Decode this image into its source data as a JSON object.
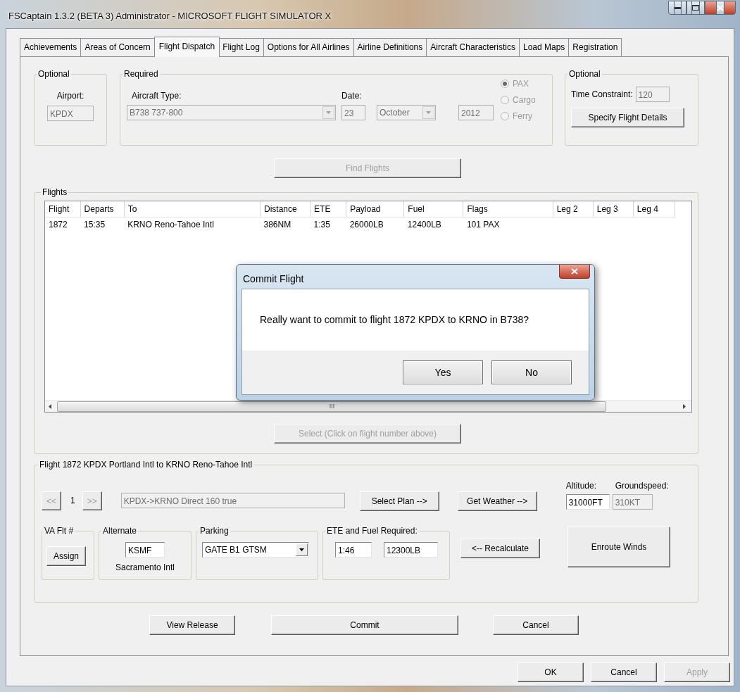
{
  "window": {
    "title": "FSCaptain 1.3.2 (BETA 3) Administrator - MICROSOFT FLIGHT SIMULATOR X"
  },
  "tabs": [
    {
      "label": "Achievements",
      "selected": false
    },
    {
      "label": "Areas of Concern",
      "selected": false
    },
    {
      "label": "Flight Dispatch",
      "selected": true
    },
    {
      "label": "Flight Log",
      "selected": false
    },
    {
      "label": "Options for All Airlines",
      "selected": false
    },
    {
      "label": "Airline Definitions",
      "selected": false
    },
    {
      "label": "Aircraft Characteristics",
      "selected": false
    },
    {
      "label": "Load Maps",
      "selected": false
    },
    {
      "label": "Registration",
      "selected": false
    }
  ],
  "dispatch": {
    "airport_group": {
      "title": "Optional",
      "label": "Airport:",
      "field": {
        "value": "KPDX",
        "disabled": true
      }
    },
    "required_group": {
      "title": "Required",
      "aircraft_label": "Aircraft Type:",
      "aircraft": {
        "value": "B738 737-800",
        "disabled": true
      },
      "date_label": "Date:",
      "day": {
        "value": "23",
        "disabled": true
      },
      "month": {
        "value": "October",
        "disabled": true
      },
      "year": {
        "value": "2012",
        "disabled": true
      },
      "load_types": [
        {
          "label": "PAX",
          "selected": true,
          "disabled": true
        },
        {
          "label": "Cargo",
          "selected": false,
          "disabled": true
        },
        {
          "label": "Ferry",
          "selected": false,
          "disabled": true
        }
      ]
    },
    "time_group": {
      "title": "Optional",
      "label": "Time Constraint:",
      "field": {
        "value": "120",
        "disabled": true
      },
      "button": {
        "label": "Specify Flight Details",
        "disabled": false
      }
    },
    "find_button": {
      "label": "Find Flights",
      "disabled": true
    }
  },
  "flights": {
    "title": "Flights",
    "columns": [
      "Flight",
      "Departs",
      "To",
      "Distance",
      "ETE",
      "Payload",
      "Fuel",
      "Flags",
      "Leg 2",
      "Leg 3",
      "Leg 4"
    ],
    "rows": [
      [
        "1872",
        "15:35",
        "KRNO Reno-Tahoe Intl",
        "386NM",
        "1:35",
        "26000LB",
        "12400LB",
        "101 PAX"
      ]
    ],
    "select_button": {
      "label": "Select (Click on flight number above)",
      "disabled": true
    }
  },
  "flight_detail": {
    "title": "Flight 1872 KPDX Portland Intl to KRNO Reno-Tahoe Intl",
    "prev_button": {
      "label": "<<",
      "disabled": true
    },
    "page": "1",
    "next_button": {
      "label": ">>",
      "disabled": true
    },
    "route": {
      "value": "KPDX->KRNO Direct 160 true",
      "disabled": true
    },
    "select_plan_button": {
      "label": "Select Plan -->",
      "disabled": false
    },
    "weather_button": {
      "label": "Get Weather -->",
      "disabled": false
    },
    "altitude": {
      "label": "Altitude:",
      "value": "31000FT",
      "disabled": false
    },
    "groundspeed": {
      "label": "Groundspeed:",
      "value": "310KT",
      "disabled": true
    },
    "va_group": {
      "title": "VA Flt #",
      "button": {
        "label": "Assign",
        "disabled": false
      }
    },
    "alternate_group": {
      "title": "Alternate",
      "field": {
        "value": "KSMF",
        "disabled": false
      },
      "caption": "Sacramento Intl"
    },
    "parking_group": {
      "title": "Parking",
      "field": {
        "value": "GATE B1 GTSM",
        "disabled": false
      }
    },
    "ete_group": {
      "title": "ETE and Fuel Required:",
      "ete": {
        "value": "1:46",
        "disabled": false
      },
      "fuel": {
        "value": "12300LB",
        "disabled": false
      }
    },
    "recalculate_button": {
      "label": "<-- Recalculate",
      "disabled": false
    },
    "winds_button": {
      "label": "Enroute Winds",
      "disabled": false
    }
  },
  "page_buttons": [
    {
      "label": "View Release",
      "disabled": false
    },
    {
      "label": "Commit",
      "disabled": false
    },
    {
      "label": "Cancel",
      "disabled": false
    }
  ],
  "dialog_buttons": [
    {
      "label": "OK",
      "disabled": false
    },
    {
      "label": "Cancel",
      "disabled": false
    },
    {
      "label": "Apply",
      "disabled": true
    }
  ],
  "message_box": {
    "title": "Commit Flight",
    "message": "Really want to commit to flight 1872 KPDX to KRNO in B738?",
    "buttons": [
      {
        "label": "Yes",
        "disabled": false
      },
      {
        "label": "No",
        "disabled": false
      }
    ]
  }
}
